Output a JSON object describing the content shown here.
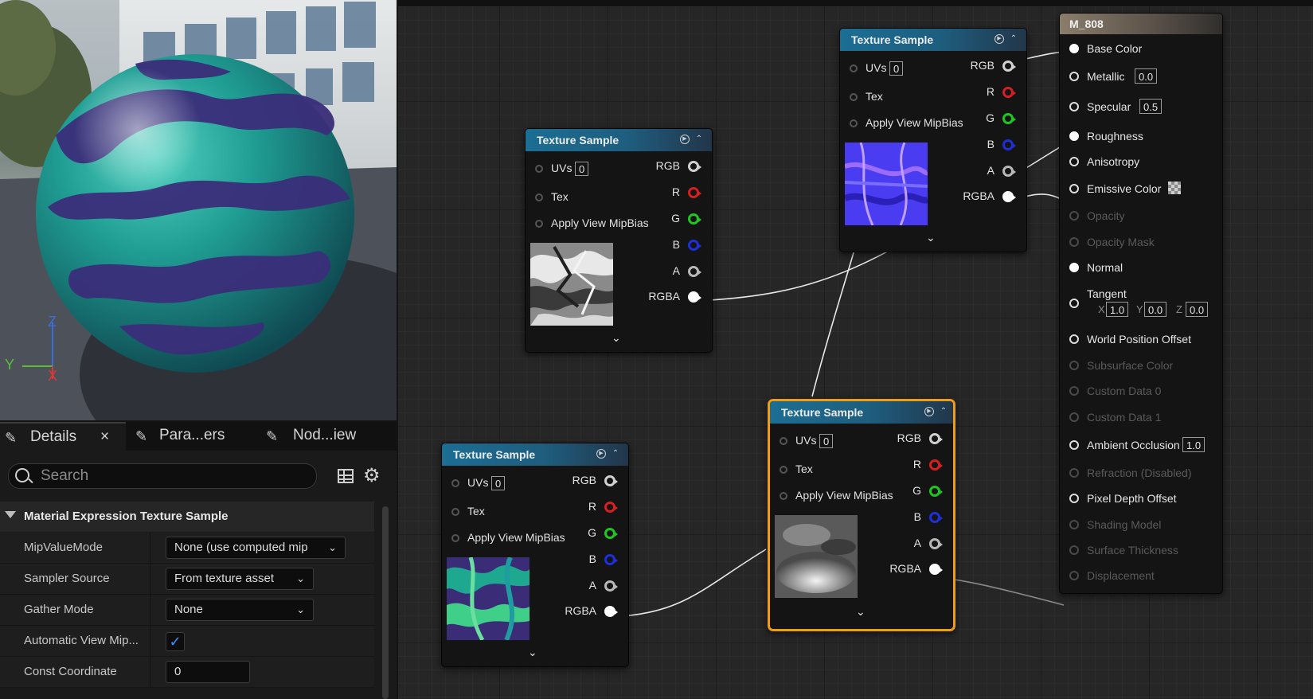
{
  "viewport": {
    "axes": {
      "z": "Z",
      "y": "Y",
      "x": "X"
    }
  },
  "details": {
    "tabs": [
      {
        "label": "Details",
        "icon": "pencil-icon",
        "close": "×"
      },
      {
        "label": "Para...ers",
        "icon": "pencil-icon"
      },
      {
        "label": "Nod...iew",
        "icon": "pencil-icon"
      }
    ],
    "search_placeholder": "Search",
    "category": "Material Expression Texture Sample",
    "props": [
      {
        "name": "MipValueMode",
        "value": "None (use computed mip"
      },
      {
        "name": "Sampler Source",
        "value": "From texture asset"
      },
      {
        "name": "Gather Mode",
        "value": "None"
      },
      {
        "name": "Automatic View Mip...",
        "checked": true
      },
      {
        "name": "Const Coordinate",
        "value": "0"
      }
    ]
  },
  "node": {
    "title": "Texture Sample",
    "uvs": "UVs",
    "uv_val": "0",
    "tex": "Tex",
    "mip": "Apply View MipBias",
    "rgb": "RGB",
    "r": "R",
    "g": "G",
    "b": "B",
    "a": "A",
    "rgba": "RGBA"
  },
  "result": {
    "title": "M_808",
    "pins": [
      {
        "label": "Base Color",
        "state": "connected"
      },
      {
        "label": "Metallic",
        "state": "on",
        "value": "0.0"
      },
      {
        "label": "Specular",
        "state": "on",
        "value": "0.5"
      },
      {
        "label": "Roughness",
        "state": "connected"
      },
      {
        "label": "Anisotropy",
        "state": "on"
      },
      {
        "label": "Emissive Color",
        "state": "on"
      },
      {
        "label": "Opacity",
        "state": "disabled"
      },
      {
        "label": "Opacity Mask",
        "state": "disabled"
      },
      {
        "label": "Normal",
        "state": "connected"
      },
      {
        "label": "Tangent",
        "state": "on"
      },
      {
        "label": "World Position Offset",
        "state": "on"
      },
      {
        "label": "Subsurface Color",
        "state": "disabled"
      },
      {
        "label": "Custom Data 0",
        "state": "disabled"
      },
      {
        "label": "Custom Data 1",
        "state": "disabled"
      },
      {
        "label": "Ambient Occlusion",
        "state": "on",
        "value": "1.0"
      },
      {
        "label": "Refraction (Disabled)",
        "state": "disabled"
      },
      {
        "label": "Pixel Depth Offset",
        "state": "on"
      },
      {
        "label": "Shading Model",
        "state": "disabled"
      },
      {
        "label": "Surface Thickness",
        "state": "disabled"
      },
      {
        "label": "Displacement",
        "state": "disabled"
      }
    ],
    "tangent": {
      "x_label": "X",
      "x": "1.0",
      "y_label": "Y",
      "y": "0.0",
      "z_label": "Z",
      "z": "0.0"
    }
  },
  "colors": {
    "r_pin": "#d42020",
    "g_pin": "#1fc61f",
    "b_pin": "#1f2fd8",
    "selection": "#f39c12"
  }
}
